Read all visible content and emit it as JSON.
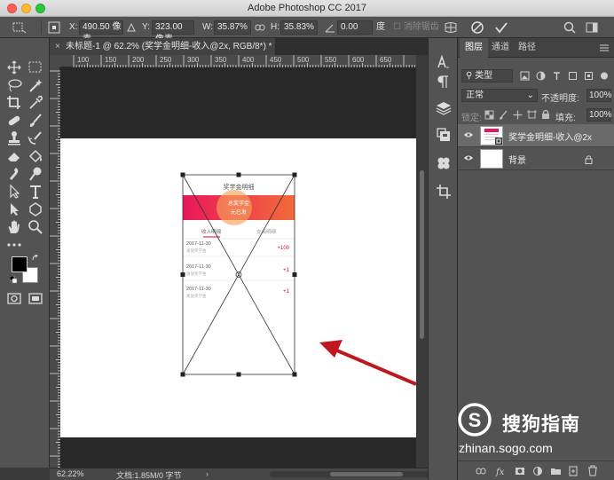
{
  "window": {
    "title": "Adobe Photoshop CC 2017"
  },
  "options_bar": {
    "x_label": "X:",
    "x_value": "490.50 像素",
    "y_label": "Y:",
    "y_value": "323.00 像素",
    "w_label": "W:",
    "w_value": "35.87%",
    "h_label": "H:",
    "h_value": "35.83%",
    "angle_value": "0.00",
    "angle_unit": "度",
    "antialias_label": "消除锯齿"
  },
  "document_tab": {
    "label": "未标题-1 @ 62.2% (奖学金明细-收入@2x, RGB/8*) *",
    "close": "×"
  },
  "rulers": {
    "h_ticks": [
      "100",
      "150",
      "200",
      "250",
      "300",
      "350",
      "400",
      "450",
      "500",
      "550",
      "600",
      "650",
      "700",
      "750",
      "800",
      "850"
    ],
    "v_ticks": [
      "0",
      "5",
      "0",
      "1",
      "0",
      "1",
      "5",
      "0",
      "2",
      "0",
      "2",
      "5",
      "0",
      "3",
      "0",
      "0",
      "3",
      "5",
      "0",
      "4",
      "0",
      "0",
      "4",
      "5",
      "0",
      "5",
      "0",
      "0",
      "5",
      "5",
      "0"
    ]
  },
  "status_bar": {
    "zoom": "62.22%",
    "doc_info": "文档:1.85M/0 字节"
  },
  "layers_panel": {
    "tabs": [
      "图层",
      "通道",
      "路径"
    ],
    "filter_label": "类型",
    "blend_mode": "正常",
    "opacity_label": "不透明度:",
    "opacity_value": "100%",
    "lock_label": "锁定:",
    "fill_label": "填充:",
    "fill_value": "100%",
    "layers": [
      {
        "name": "奖学金明细-收入@2x",
        "selected": true
      },
      {
        "name": "背景",
        "selected": false,
        "locked": true
      }
    ]
  },
  "mockup": {
    "header_title": "奖学金明细",
    "banner_line1": "总奖学金",
    "banner_line2": "元已发",
    "tab_income": "收入明细",
    "tab_expense": "支出明细",
    "rows": [
      {
        "date": "2017-11-30",
        "desc": "发放奖学金",
        "amount": "+100"
      },
      {
        "date": "2017-11-30",
        "desc": "发放奖学金",
        "amount": "+1"
      },
      {
        "date": "2017-11-30",
        "desc": "发放奖学金",
        "amount": "+1"
      }
    ]
  },
  "watermark": {
    "brand": "搜狗指南",
    "url": "zhinan.sogo.com"
  },
  "colors": {
    "accent_red": "#c4132b",
    "arrow": "#c0161e",
    "banner_start": "#e8185a",
    "banner_end": "#f36b3a"
  }
}
